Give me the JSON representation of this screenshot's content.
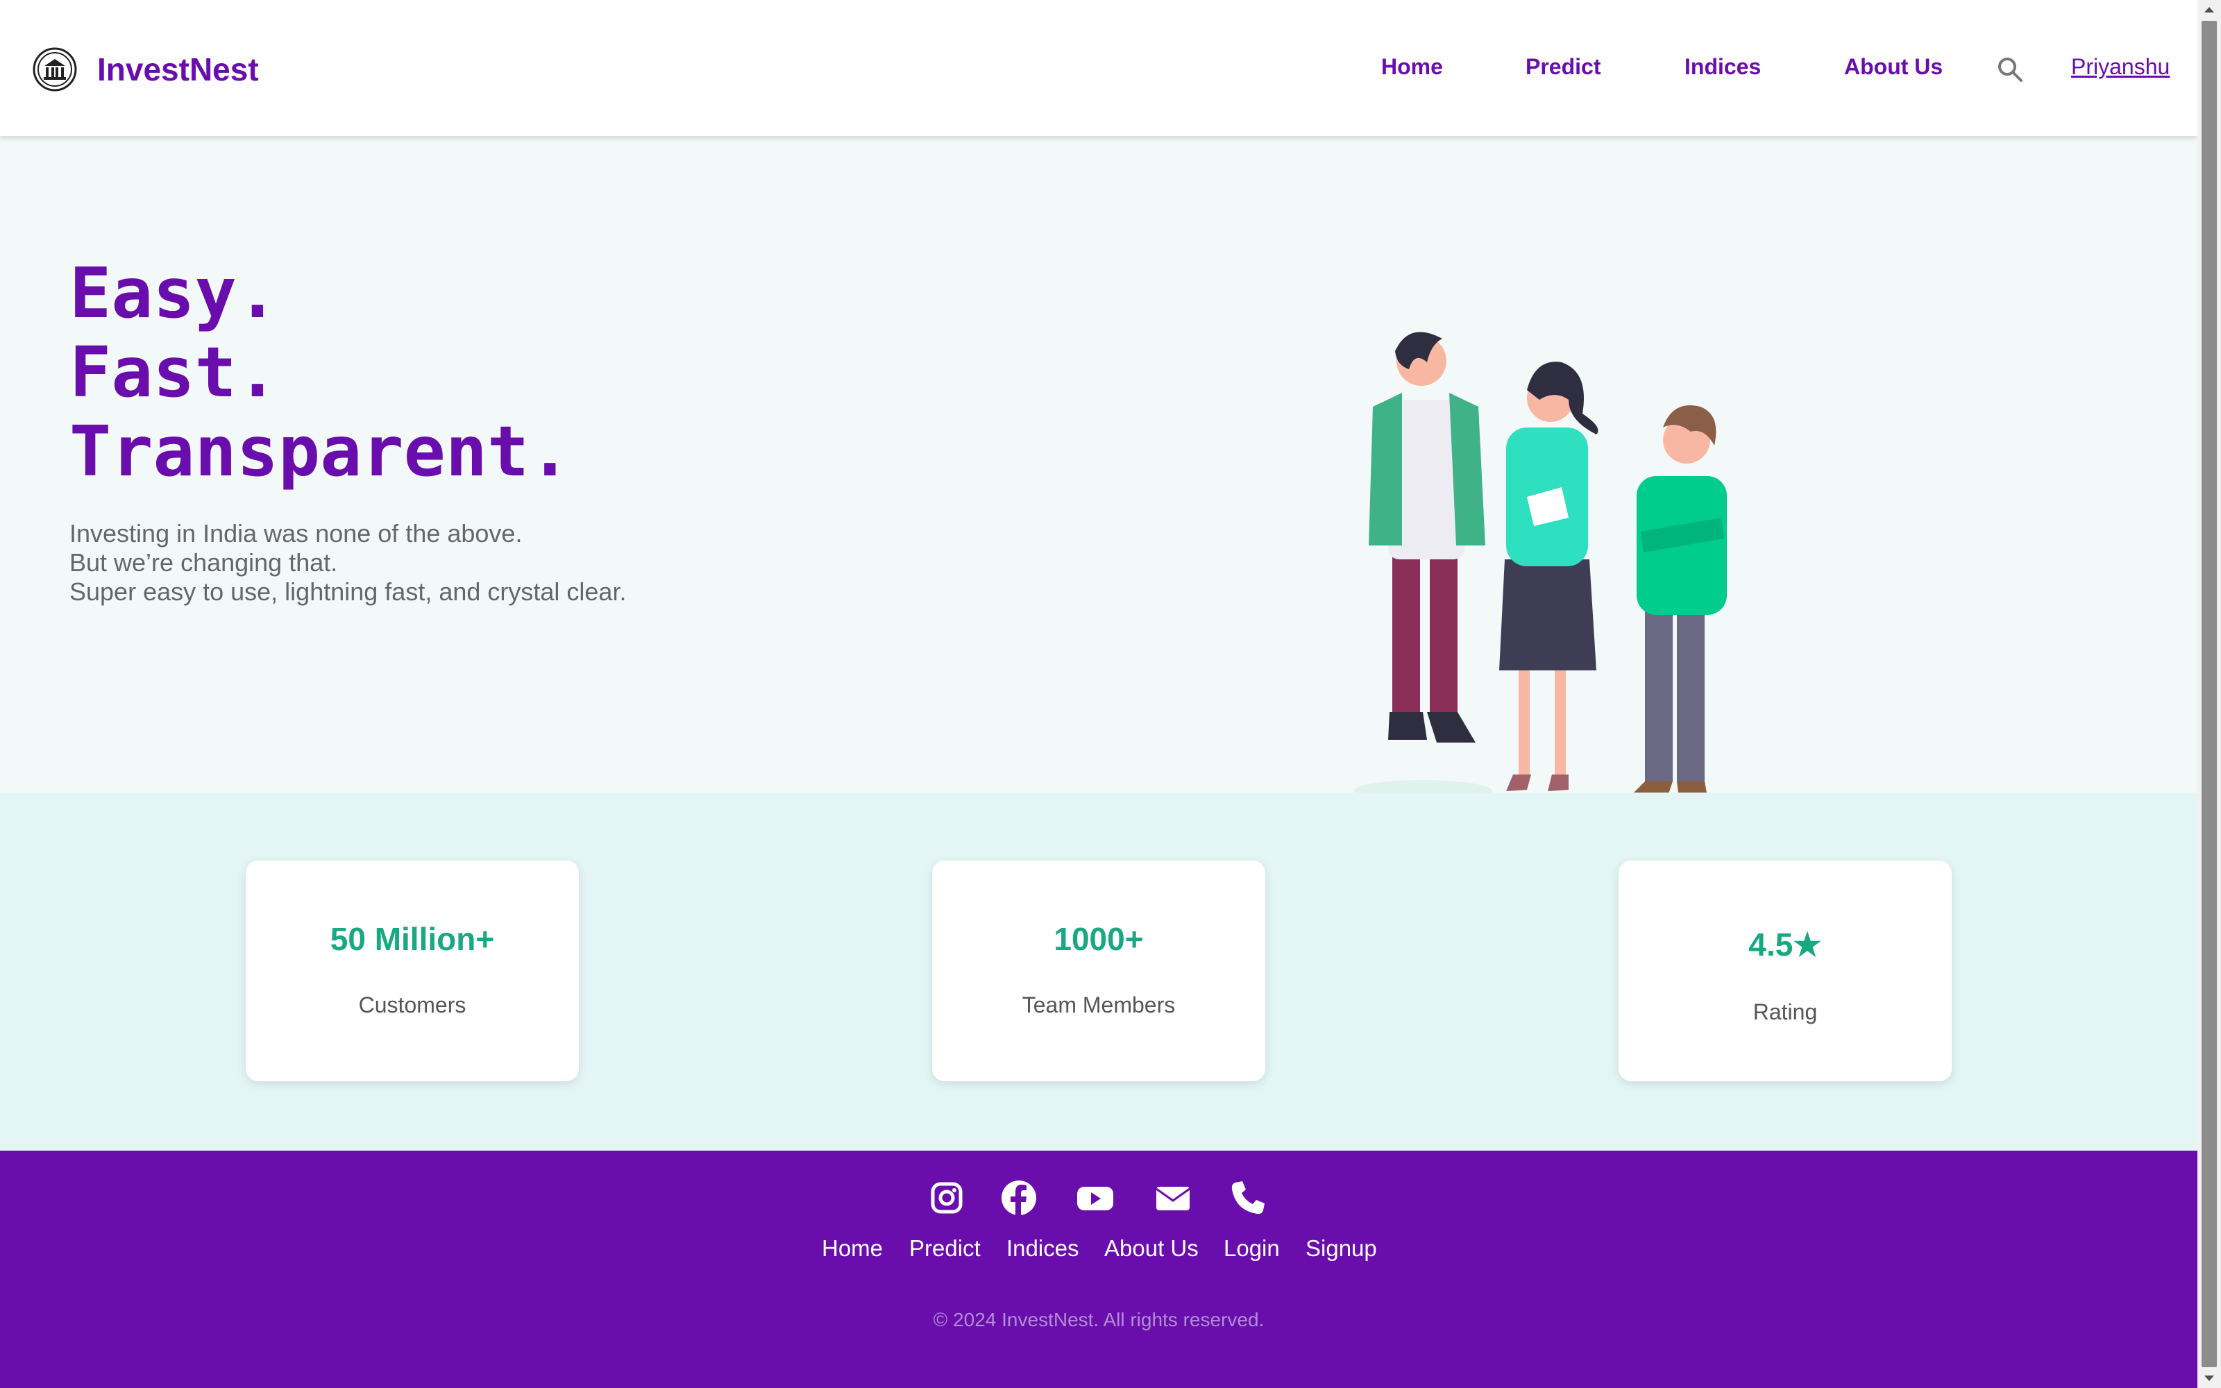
{
  "brand": {
    "name": "InvestNest",
    "logo_icon": "bank-logo-icon"
  },
  "nav": {
    "items": [
      {
        "label": "Home"
      },
      {
        "label": "Predict"
      },
      {
        "label": "Indices"
      },
      {
        "label": "About Us"
      }
    ],
    "search_icon": "search-icon",
    "user": "Priyanshu"
  },
  "hero": {
    "headline": [
      "Easy.",
      "Fast.",
      "Transparent."
    ],
    "lines": [
      "Investing in India was none of the above.",
      "But we’re changing that.",
      "Super easy to use, lightning fast, and crystal clear."
    ]
  },
  "stats": [
    {
      "value": "50 Million+",
      "label": "Customers"
    },
    {
      "value": "1000+",
      "label": "Team Members"
    },
    {
      "value": "4.5★",
      "label": "Rating"
    }
  ],
  "footer": {
    "social_icons": [
      "instagram-icon",
      "facebook-icon",
      "youtube-icon",
      "email-icon",
      "phone-icon"
    ],
    "links": [
      {
        "label": "Home"
      },
      {
        "label": "Predict"
      },
      {
        "label": "Indices"
      },
      {
        "label": "About Us"
      },
      {
        "label": "Login"
      },
      {
        "label": "Signup"
      }
    ],
    "copyright": "© 2024 InvestNest. All rights reserved."
  },
  "colors": {
    "brand": "#6a0dad",
    "accent": "#18a883",
    "hero_bg": "#f3f9f9",
    "stats_bg": "#e4f5f5"
  }
}
